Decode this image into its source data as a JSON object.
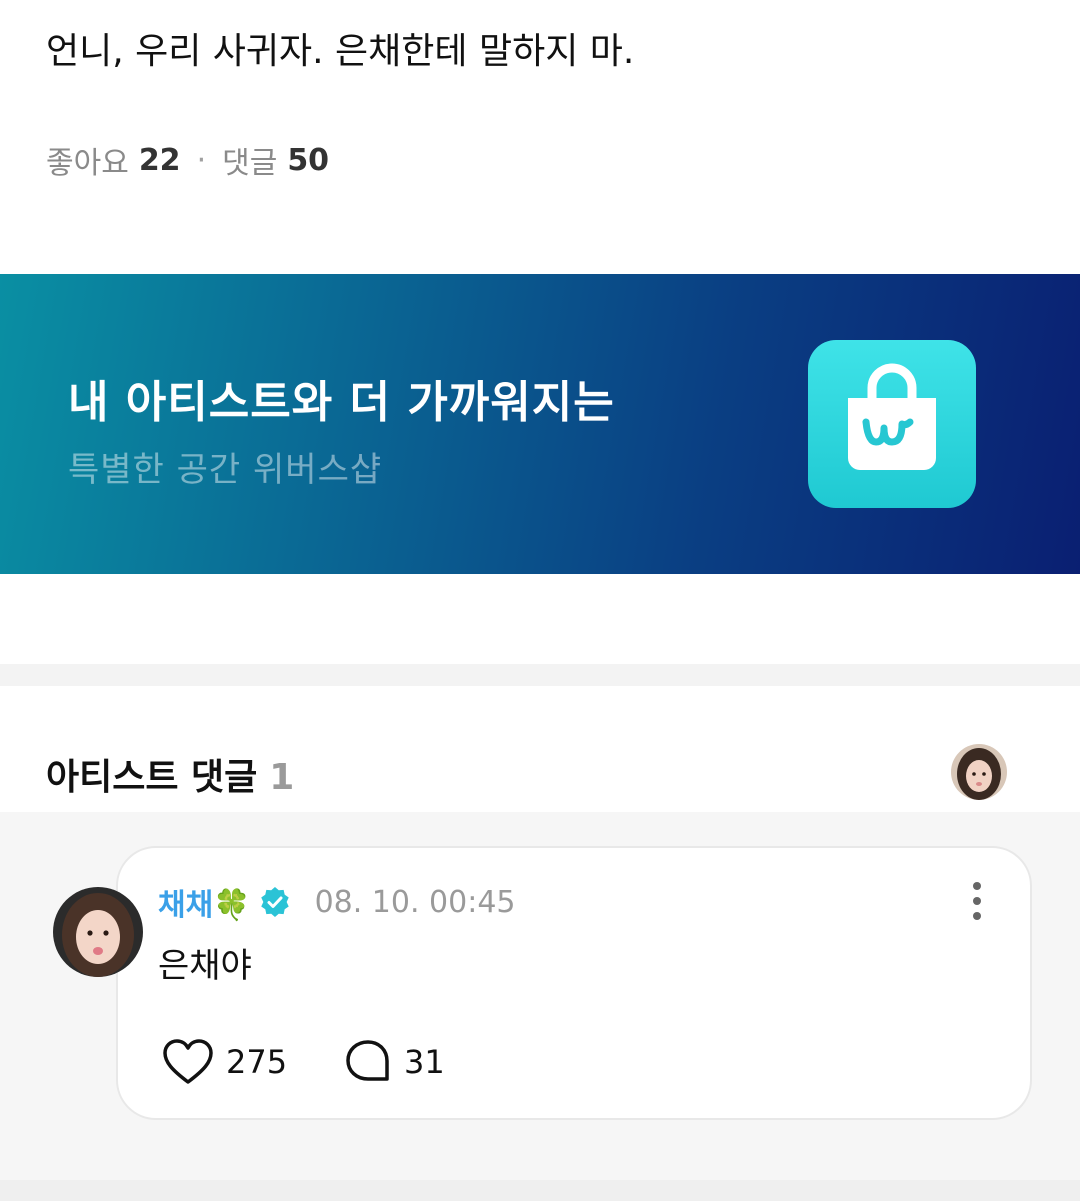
{
  "post": {
    "text": "언니, 우리 사귀자. 은채한테 말하지 마.",
    "likes_label": "좋아요",
    "likes_count": "22",
    "separator": "·",
    "comments_label": "댓글",
    "comments_count": "50"
  },
  "banner": {
    "title": "내 아티스트와 더 가까워지는",
    "subtitle": "특별한 공간 위버스샵",
    "logo_icon": "shopping-bag-icon",
    "logo_color": "#2fd6dd"
  },
  "artist_comments": {
    "title": "아티스트 댓글",
    "count": "1",
    "comment": {
      "author": "채채🍀",
      "verified_icon": "verified-badge-icon",
      "time": "08. 10. 00:45",
      "body": "은채야",
      "likes": "275",
      "replies": "31"
    }
  },
  "colors": {
    "author": "#3aa0e8",
    "verified": "#2bc3d6",
    "banner_start": "#0a8fa3",
    "banner_end": "#0a1f72"
  }
}
